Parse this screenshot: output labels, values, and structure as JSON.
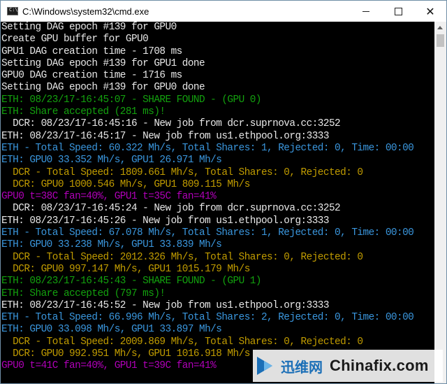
{
  "window": {
    "title": "C:\\Windows\\system32\\cmd.exe",
    "icon_label": "C:\\",
    "buttons": {
      "minimize": "minimize",
      "maximize": "maximize",
      "close": "✕"
    }
  },
  "colors": {
    "background": "#000000",
    "white": "#e8e8e8",
    "green": "#13a10e",
    "cyan": "#3a96dd",
    "yellow": "#c19c00",
    "purple": "#b000b8"
  },
  "console_lines": [
    {
      "color": "white",
      "text": "Setting DAG epoch #139 for GPU0"
    },
    {
      "color": "white",
      "text": "Create GPU buffer for GPU0"
    },
    {
      "color": "white",
      "text": "GPU1 DAG creation time - 1708 ms"
    },
    {
      "color": "white",
      "text": "Setting DAG epoch #139 for GPU1 done"
    },
    {
      "color": "white",
      "text": "GPU0 DAG creation time - 1716 ms"
    },
    {
      "color": "white",
      "text": "Setting DAG epoch #139 for GPU0 done"
    },
    {
      "color": "green",
      "text": "ETH: 08/23/17-16:45:07 - SHARE FOUND - (GPU 0)"
    },
    {
      "color": "green",
      "text": "ETH: Share accepted (281 ms)!"
    },
    {
      "color": "white",
      "text": "  DCR: 08/23/17-16:45:16 - New job from dcr.suprnova.cc:3252"
    },
    {
      "color": "white",
      "text": "ETH: 08/23/17-16:45:17 - New job from us1.ethpool.org:3333"
    },
    {
      "color": "cyan",
      "text": "ETH - Total Speed: 60.322 Mh/s, Total Shares: 1, Rejected: 0, Time: 00:00"
    },
    {
      "color": "cyan",
      "text": "ETH: GPU0 33.352 Mh/s, GPU1 26.971 Mh/s"
    },
    {
      "color": "yellow",
      "text": "  DCR - Total Speed: 1809.661 Mh/s, Total Shares: 0, Rejected: 0"
    },
    {
      "color": "yellow",
      "text": "  DCR: GPU0 1000.546 Mh/s, GPU1 809.115 Mh/s"
    },
    {
      "color": "purple",
      "text": "GPU0 t=38C fan=40%, GPU1 t=35C fan=41%"
    },
    {
      "color": "white",
      "text": "  DCR: 08/23/17-16:45:24 - New job from dcr.suprnova.cc:3252"
    },
    {
      "color": "white",
      "text": "ETH: 08/23/17-16:45:26 - New job from us1.ethpool.org:3333"
    },
    {
      "color": "cyan",
      "text": "ETH - Total Speed: 67.078 Mh/s, Total Shares: 1, Rejected: 0, Time: 00:00"
    },
    {
      "color": "cyan",
      "text": "ETH: GPU0 33.238 Mh/s, GPU1 33.839 Mh/s"
    },
    {
      "color": "yellow",
      "text": "  DCR - Total Speed: 2012.326 Mh/s, Total Shares: 0, Rejected: 0"
    },
    {
      "color": "yellow",
      "text": "  DCR: GPU0 997.147 Mh/s, GPU1 1015.179 Mh/s"
    },
    {
      "color": "green",
      "text": "ETH: 08/23/17-16:45:43 - SHARE FOUND - (GPU 1)"
    },
    {
      "color": "green",
      "text": "ETH: Share accepted (797 ms)!"
    },
    {
      "color": "white",
      "text": "ETH: 08/23/17-16:45:52 - New job from us1.ethpool.org:3333"
    },
    {
      "color": "cyan",
      "text": "ETH - Total Speed: 66.996 Mh/s, Total Shares: 2, Rejected: 0, Time: 00:00"
    },
    {
      "color": "cyan",
      "text": "ETH: GPU0 33.098 Mh/s, GPU1 33.897 Mh/s"
    },
    {
      "color": "yellow",
      "text": "  DCR - Total Speed: 2009.869 Mh/s, Total Shares: 0, Rejected: 0"
    },
    {
      "color": "yellow",
      "text": "  DCR: GPU0 992.951 Mh/s, GPU1 1016.918 Mh/s"
    },
    {
      "color": "purple",
      "text": "GPU0 t=41C fan=40%, GPU1 t=39C fan=41%"
    }
  ],
  "watermark": {
    "chinese_text": "迅维网",
    "english_text": "Chinafix.com"
  }
}
